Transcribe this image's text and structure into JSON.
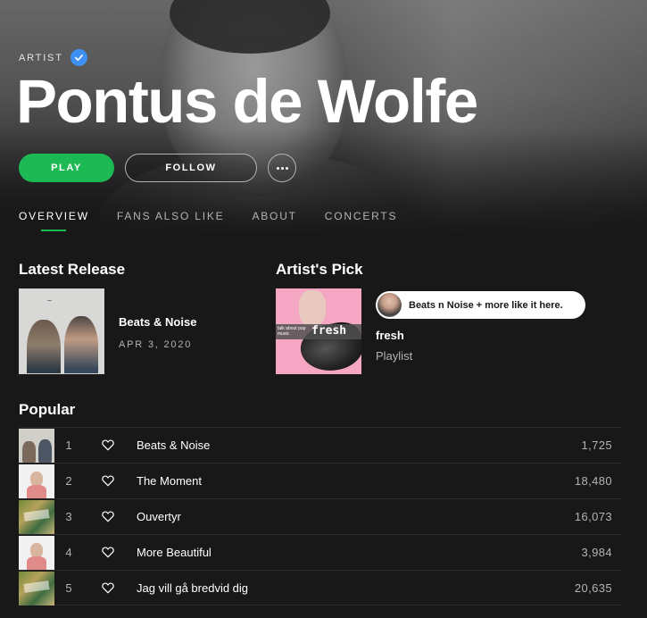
{
  "artist": {
    "tag": "ARTIST",
    "name": "Pontus de Wolfe",
    "verified": true
  },
  "actions": {
    "play_label": "PLAY",
    "follow_label": "FOLLOW",
    "more_icon": "more-icon"
  },
  "tabs": [
    {
      "label": "OVERVIEW",
      "active": true
    },
    {
      "label": "FANS ALSO LIKE",
      "active": false
    },
    {
      "label": "ABOUT",
      "active": false
    },
    {
      "label": "CONCERTS",
      "active": false
    }
  ],
  "latest_release": {
    "section_title": "Latest Release",
    "title": "Beats & Noise",
    "date": "APR 3, 2020"
  },
  "artists_pick": {
    "section_title": "Artist's Pick",
    "note": "Beats n Noise + more like it here.",
    "title": "fresh",
    "type": "Playlist",
    "cover_text": "fresh",
    "cover_subtext": "talk about pop music"
  },
  "popular": {
    "section_title": "Popular",
    "tracks": [
      {
        "num": "1",
        "title": "Beats & Noise",
        "plays": "1,725"
      },
      {
        "num": "2",
        "title": "The Moment",
        "plays": "18,480"
      },
      {
        "num": "3",
        "title": "Ouvertyr",
        "plays": "16,073"
      },
      {
        "num": "4",
        "title": "More Beautiful",
        "plays": "3,984"
      },
      {
        "num": "5",
        "title": "Jag vill gå bredvid dig",
        "plays": "20,635"
      }
    ]
  },
  "colors": {
    "accent": "#1db954",
    "background": "#181818",
    "verified": "#3d91f4"
  }
}
